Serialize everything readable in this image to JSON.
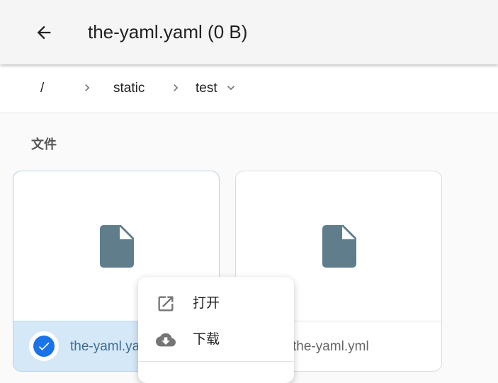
{
  "header": {
    "title": "the-yaml.yaml (0 B)"
  },
  "breadcrumb": {
    "items": [
      {
        "label": "/"
      },
      {
        "label": "static"
      },
      {
        "label": "test"
      }
    ]
  },
  "main": {
    "section_title": "文件",
    "files": [
      {
        "name": "the-yaml.yaml",
        "selected": true
      },
      {
        "name": "the-yaml.yml",
        "selected": false
      }
    ]
  },
  "context_menu": {
    "items": [
      {
        "label": "打开",
        "icon": "open-in-new-icon"
      },
      {
        "label": "下载",
        "icon": "cloud-download-icon"
      }
    ]
  },
  "colors": {
    "accent": "#1a73e8",
    "file_icon": "#607d8b",
    "selected_bg": "#d5e8f8"
  }
}
